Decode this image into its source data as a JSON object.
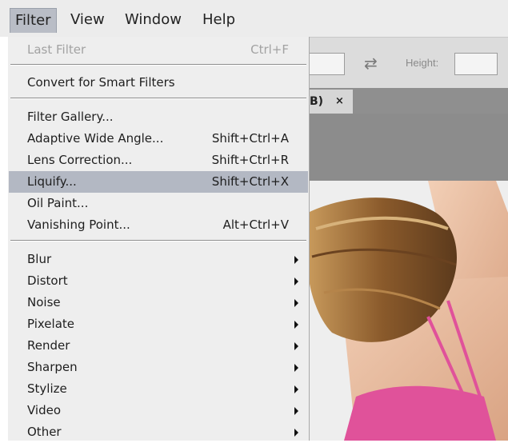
{
  "menubar": {
    "items": [
      {
        "label": "Filter"
      },
      {
        "label": "View"
      },
      {
        "label": "Window"
      },
      {
        "label": "Help"
      }
    ]
  },
  "options_bar": {
    "swap_icon": "swap-arrows-icon",
    "height_label": "Height:"
  },
  "document_tab": {
    "label": "B)",
    "close": "×"
  },
  "filter_menu": {
    "items": [
      {
        "label": "Last Filter",
        "shortcut": "Ctrl+F",
        "disabled": true
      },
      {
        "label": "Convert for Smart Filters"
      },
      {
        "label": "Filter Gallery..."
      },
      {
        "label": "Adaptive Wide Angle...",
        "shortcut": "Shift+Ctrl+A"
      },
      {
        "label": "Lens Correction...",
        "shortcut": "Shift+Ctrl+R"
      },
      {
        "label": "Liquify...",
        "shortcut": "Shift+Ctrl+X",
        "highlighted": true
      },
      {
        "label": "Oil Paint..."
      },
      {
        "label": "Vanishing Point...",
        "shortcut": "Alt+Ctrl+V"
      },
      {
        "label": "Blur",
        "submenu": true
      },
      {
        "label": "Distort",
        "submenu": true
      },
      {
        "label": "Noise",
        "submenu": true
      },
      {
        "label": "Pixelate",
        "submenu": true
      },
      {
        "label": "Render",
        "submenu": true
      },
      {
        "label": "Sharpen",
        "submenu": true
      },
      {
        "label": "Stylize",
        "submenu": true
      },
      {
        "label": "Video",
        "submenu": true
      },
      {
        "label": "Other",
        "submenu": true
      }
    ]
  },
  "colors": {
    "menu_bg": "#eeeeee",
    "highlight": "#b3b8c3",
    "disabled_text": "#a2a2a2",
    "shirt_pink": "#e0529a",
    "hair_brown": "#8a5a2b"
  }
}
